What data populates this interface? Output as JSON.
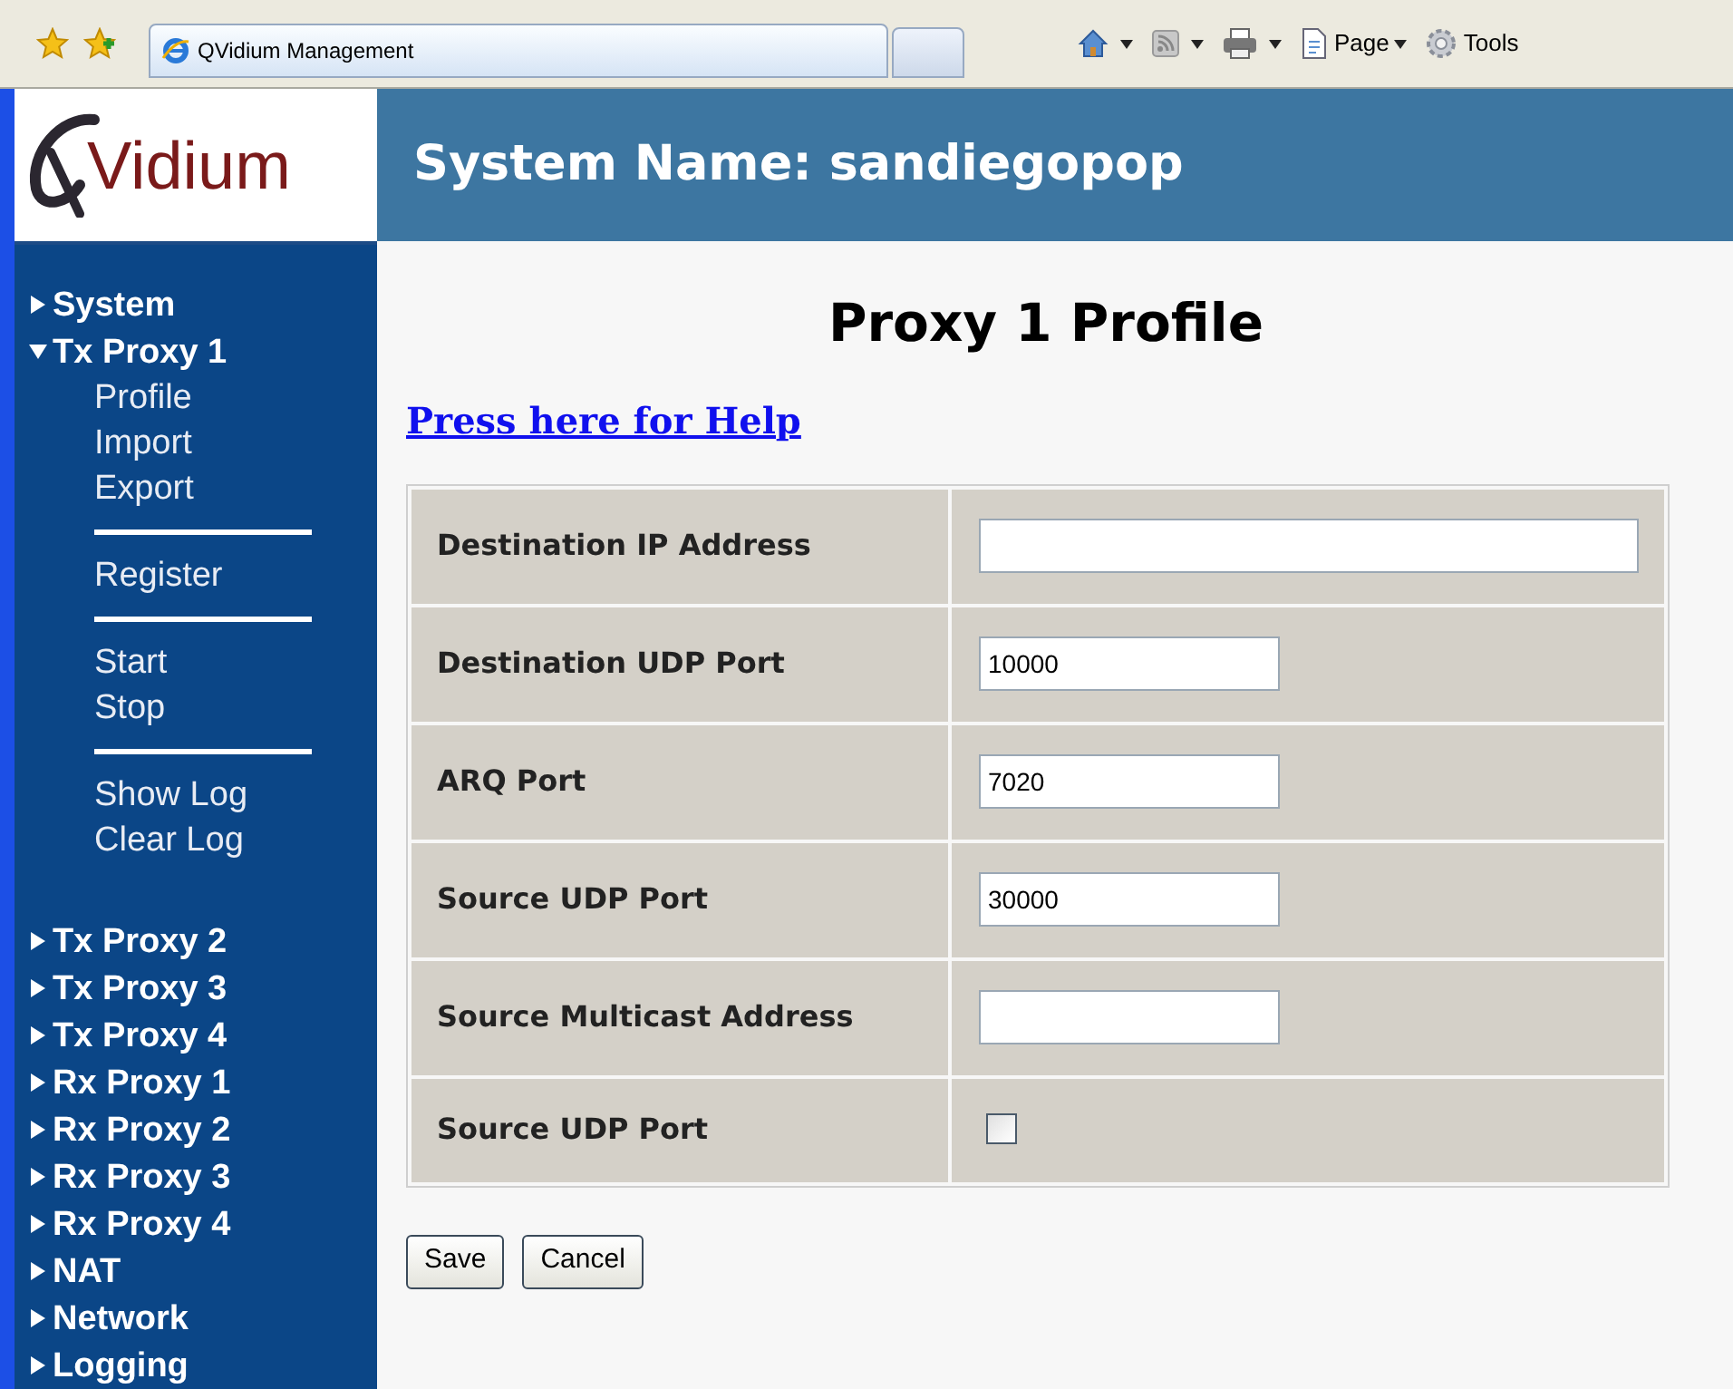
{
  "browser": {
    "tab_title": "QVidium Management",
    "commands": [
      {
        "kind": "home"
      },
      {
        "kind": "feed"
      },
      {
        "kind": "print"
      },
      {
        "kind": "page",
        "label": "Page"
      },
      {
        "kind": "tools",
        "label": "Tools"
      }
    ]
  },
  "header": {
    "logo_text": "Vidium",
    "title": "System Name: sandiegopop"
  },
  "sidebar": {
    "items": [
      {
        "label": "System",
        "expanded": false
      },
      {
        "label": "Tx Proxy 1",
        "expanded": true,
        "children": [
          {
            "kind": "link",
            "label": "Profile"
          },
          {
            "kind": "link",
            "label": "Import"
          },
          {
            "kind": "link",
            "label": "Export"
          },
          {
            "kind": "divider"
          },
          {
            "kind": "link",
            "label": "Register"
          },
          {
            "kind": "divider"
          },
          {
            "kind": "link",
            "label": "Start"
          },
          {
            "kind": "link",
            "label": "Stop"
          },
          {
            "kind": "divider"
          },
          {
            "kind": "link",
            "label": "Show Log"
          },
          {
            "kind": "link",
            "label": "Clear Log"
          }
        ]
      },
      {
        "label": "Tx Proxy 2",
        "expanded": false
      },
      {
        "label": "Tx Proxy 3",
        "expanded": false
      },
      {
        "label": "Tx Proxy 4",
        "expanded": false
      },
      {
        "label": "Rx Proxy 1",
        "expanded": false
      },
      {
        "label": "Rx Proxy 2",
        "expanded": false
      },
      {
        "label": "Rx Proxy 3",
        "expanded": false
      },
      {
        "label": "Rx Proxy 4",
        "expanded": false
      },
      {
        "label": "NAT",
        "expanded": false
      },
      {
        "label": "Network",
        "expanded": false
      },
      {
        "label": "Logging",
        "expanded": false
      }
    ]
  },
  "page": {
    "title": "Proxy 1 Profile",
    "help_link": "Press here for Help",
    "rows": [
      {
        "kind": "text",
        "label": "Destination IP Address",
        "wide": true
      },
      {
        "kind": "text",
        "label": "Destination UDP Port",
        "value": "10000",
        "wide": false
      },
      {
        "kind": "text",
        "label": "ARQ Port",
        "value": "7020",
        "wide": false
      },
      {
        "kind": "text",
        "label": "Source UDP Port",
        "value": "30000",
        "wide": false
      },
      {
        "kind": "text",
        "label": "Source Multicast Address",
        "wide": false
      },
      {
        "kind": "checkbox",
        "label": "Source UDP Port",
        "checked": false
      }
    ],
    "buttons": [
      "Save",
      "Cancel"
    ]
  }
}
